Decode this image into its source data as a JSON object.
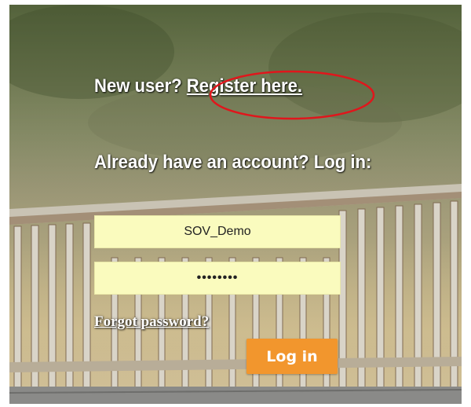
{
  "register": {
    "prompt": "New user?",
    "link_label": "Register here."
  },
  "login": {
    "heading": "Already have an account? Log in:",
    "username_value": "SOV_Demo",
    "password_value": "SOV_Demo",
    "forgot_label": "Forgot password?",
    "button_label": "Log in"
  },
  "colors": {
    "field_background": "#fafbbe",
    "button": "#f2962d",
    "annotation_circle": "#e0161c",
    "text": "#ffffff"
  }
}
